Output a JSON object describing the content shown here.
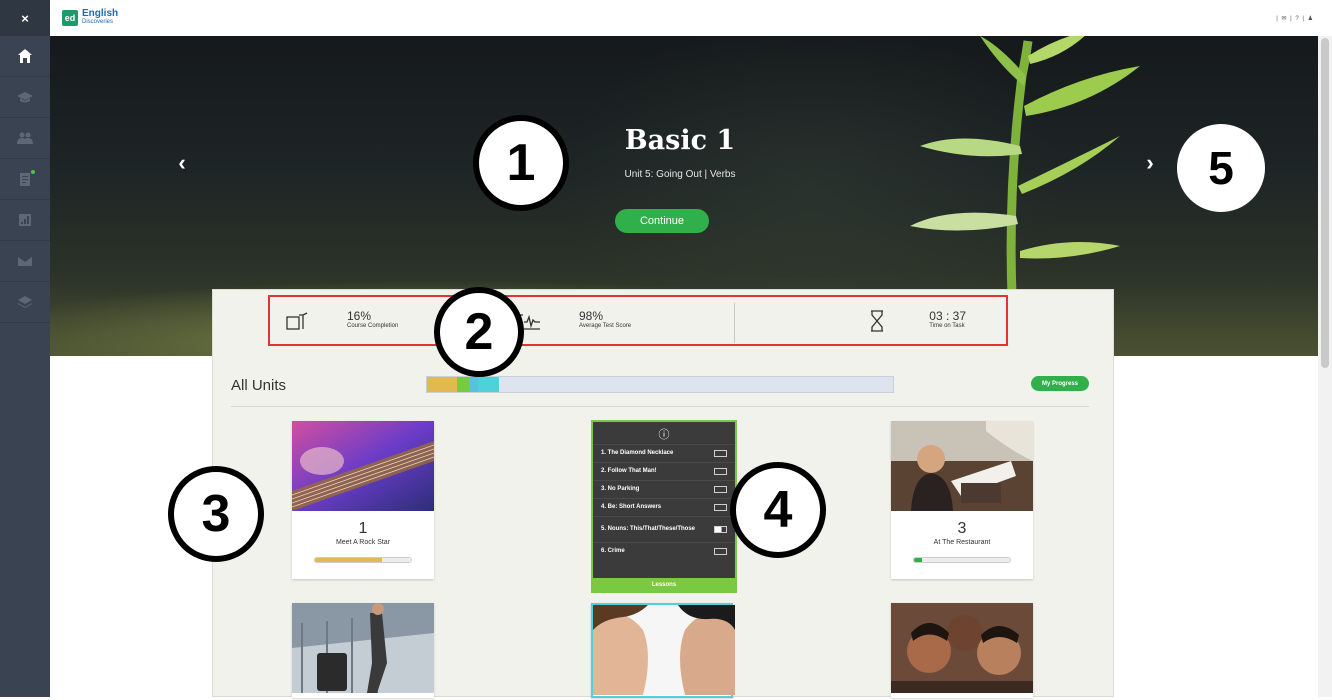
{
  "sidebar": {
    "close_label": "×",
    "items": [
      {
        "icon": "home-icon"
      },
      {
        "icon": "graduation-cap-icon"
      },
      {
        "icon": "people-icon"
      },
      {
        "icon": "assignment-icon"
      },
      {
        "icon": "report-icon"
      },
      {
        "icon": "mail-icon"
      },
      {
        "icon": "book-icon"
      }
    ]
  },
  "header": {
    "logo_badge": "ed",
    "logo_title": "English",
    "logo_subtitle": "Discoveries",
    "utilities": "| ✉ | ? | ♟"
  },
  "hero": {
    "title": "Basic 1",
    "subtitle": "Unit 5: Going Out | Verbs",
    "continue_label": "Continue",
    "prev_label": "‹",
    "next_label": "›"
  },
  "callouts": [
    "1",
    "2",
    "3",
    "4",
    "5"
  ],
  "stats": [
    {
      "icon": "completion-flag-icon",
      "value": "16%",
      "label": "Course Completion"
    },
    {
      "icon": "test-score-graph-icon",
      "value": "98%",
      "label": "Average Test Score"
    },
    {
      "icon": "hourglass-icon",
      "value": "03 : 37",
      "label": "Time on Task"
    }
  ],
  "units": {
    "title": "All Units",
    "my_progress_label": "My Progress",
    "progress_segments": [
      {
        "color": "#e2b94e",
        "fraction": 0.065
      },
      {
        "color": "#7ac943",
        "fraction": 0.025
      },
      {
        "color": "#5bc0de",
        "fraction": 0.02
      },
      {
        "color": "#4fd1d9",
        "fraction": 0.045
      }
    ],
    "cards": [
      {
        "number": "1",
        "name": "Meet A Rock Star",
        "progress": 0.7,
        "bar_color": "#e2b94e"
      },
      {
        "number": "3",
        "name": "At The Restaurant",
        "progress": 0.08,
        "bar_color": "#2fb04b"
      }
    ],
    "lessons": {
      "info_icon": "ⓘ",
      "items": [
        {
          "name": "1. The Diamond Necklace",
          "status": "empty"
        },
        {
          "name": "2. Follow That Man!",
          "status": "empty"
        },
        {
          "name": "3. No Parking",
          "status": "empty"
        },
        {
          "name": "4. Be: Short Answers",
          "status": "empty"
        },
        {
          "name": "5. Nouns: This/That/These/Those",
          "status": "partial"
        },
        {
          "name": "6. Crime",
          "status": "empty"
        }
      ],
      "footer_label": "Lessons"
    }
  },
  "colors": {
    "accent_green": "#2fb04b",
    "highlight_red": "#e53232",
    "lesson_green": "#7ac943",
    "sidebar": "#3a4351"
  }
}
